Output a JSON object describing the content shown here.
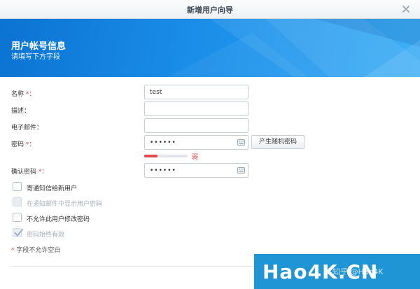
{
  "window": {
    "title": "新增用户向导"
  },
  "header": {
    "title": "用户帐号信息",
    "subtitle": "请填写下方字段"
  },
  "form": {
    "name_label": "名称",
    "name_value": "test",
    "desc_label": "描述：",
    "desc_value": "",
    "email_label": "电子邮件：",
    "email_value": "",
    "password_label": "密码",
    "password_value": "••••••",
    "random_password_button": "产生随机密码",
    "strength_label": "弱",
    "strength_level": 0.3,
    "confirm_label": "确认密码",
    "confirm_value": "••••••",
    "required_mark": "*：",
    "req_star": "*",
    "required_note": "字段不允许空白"
  },
  "options": [
    {
      "label": "寄通知信给新用户",
      "checked": false,
      "disabled": false
    },
    {
      "label": "在通知邮件中显示用户密码",
      "checked": false,
      "disabled": true
    },
    {
      "label": "不允许此用户修改密码",
      "checked": false,
      "disabled": false
    },
    {
      "label": "密码始终有效",
      "checked": true,
      "disabled": true
    }
  ],
  "watermark": {
    "brand": "Hao4K.CN",
    "credit": "知乎 @Hao4K"
  },
  "colors": {
    "accent": "#1a8de8",
    "required": "#e24a4a",
    "watermark_bg": "#1f95d5"
  }
}
